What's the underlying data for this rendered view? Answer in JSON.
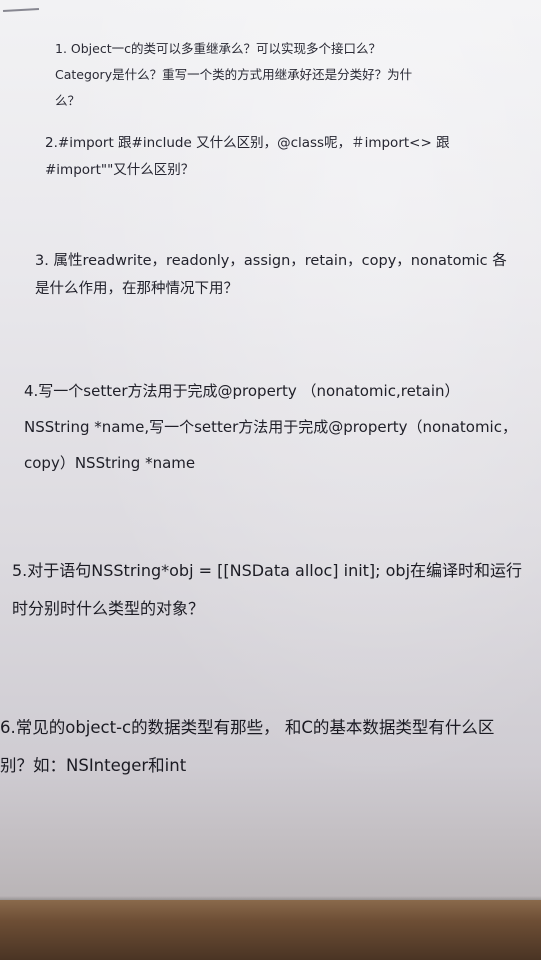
{
  "q1": {
    "lines": [
      "1.   Object一c的类可以多重继承么？可以实现多个接口么？",
      "Category是什么？重写一个类的方式用继承好还是分类好？为什",
      "么？"
    ]
  },
  "q2": {
    "lines": [
      "2.#import 跟#include 又什么区别，@class呢，＃import<> 跟",
      "#import\"\"又什么区别？"
    ]
  },
  "q3": {
    "lines": [
      "3. 属性readwrite，readonly，assign，retain，copy，nonatomic 各",
      "是什么作用，在那种情况下用？"
    ]
  },
  "q4": {
    "lines": [
      "4.写一个setter方法用于完成@property （nonatomic,retain）",
      "NSString *name,写一个setter方法用于完成@property（nonatomic，",
      "copy）NSString *name"
    ]
  },
  "q5": {
    "lines": [
      "5.对于语句NSString*obj = [[NSData alloc] init]; obj在编译时和运行",
      "时分别时什么类型的对象？"
    ]
  },
  "q6": {
    "lines": [
      "6.常见的object-c的数据类型有那些， 和C的基本数据类型有什么区",
      "别？如：NSInteger和int"
    ]
  }
}
